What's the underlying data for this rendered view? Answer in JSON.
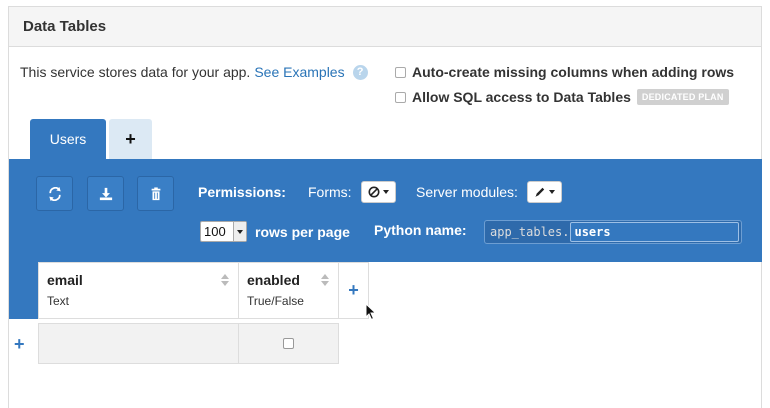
{
  "panel": {
    "title": "Data Tables"
  },
  "intro": {
    "text": "This service stores data for your app.",
    "link": "See Examples",
    "help_icon": "question-icon"
  },
  "options": {
    "auto_create_label": "Auto-create missing columns when adding rows",
    "auto_create_checked": false,
    "sql_access_label": "Allow SQL access to Data Tables",
    "sql_access_checked": false,
    "badge": "DEDICATED PLAN"
  },
  "tabs": [
    {
      "label": "Users",
      "active": true
    },
    {
      "label": "+",
      "active": false
    }
  ],
  "toolbar": {
    "buttons": [
      "refresh-icon",
      "download-icon",
      "trash-icon"
    ],
    "permissions_label": "Permissions:",
    "forms_label": "Forms:",
    "forms_value_icon": "no-access-icon",
    "server_modules_label": "Server modules:",
    "server_modules_value_icon": "pencil-icon",
    "rows_value": "100",
    "rows_label": "rows per page",
    "python_name_label": "Python name:",
    "python_prefix": "app_tables.",
    "python_table": "users"
  },
  "table": {
    "columns": [
      {
        "name": "email",
        "type": "Text"
      },
      {
        "name": "enabled",
        "type": "True/False"
      }
    ],
    "add_column": "+",
    "add_row": "+",
    "rows": [
      {
        "email": "",
        "enabled": false
      }
    ]
  },
  "colors": {
    "accent": "#3478bf",
    "tab_inactive": "#dce9f4",
    "link": "#2a74b7"
  }
}
